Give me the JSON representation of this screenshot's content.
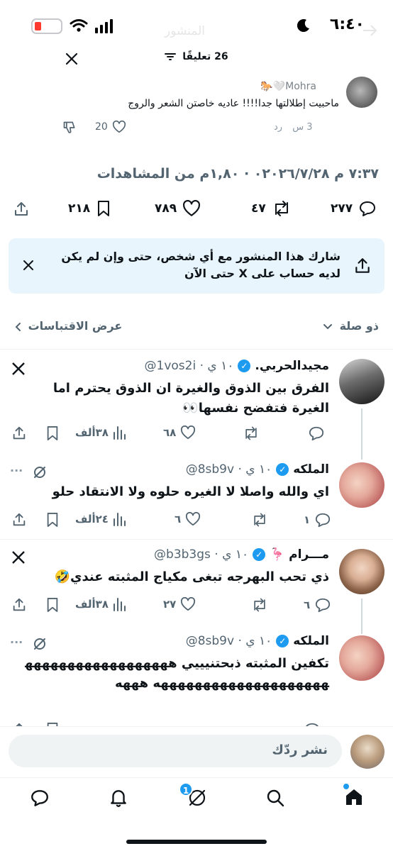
{
  "status_bar": {
    "time": "٦:٤٠",
    "ghost_title": "المنشور"
  },
  "sheet": {
    "comment_count": "26 تعليقًا"
  },
  "reply_preview": {
    "name": "Mohra🤍🐎",
    "text": "ماحبيت إطلالتها جدا!!!! عاديه خاصتن الشعر والروج",
    "time": "3 س",
    "reply_label": "رد",
    "likes": "20"
  },
  "post_meta": {
    "line": "٧:٣٧ م ٠٢٠٢٦/٧/٢٨ · ١,٨٠م من المشاهدات"
  },
  "post_actions": {
    "replies": "٢٧٧",
    "reposts": "٤٧",
    "likes": "٧٨٩",
    "bookmarks": "٢١٨"
  },
  "share_prompt": {
    "text": "شارك هذا المنشور مع أي شخص، حتى وإن لم يكن لديه حساب على X حتى الآن"
  },
  "sort_row": {
    "sort_label": "ذو صلة",
    "quotes_label": "عرض الاقتباسات"
  },
  "tweets": [
    {
      "name": "مجيدالحربي.",
      "handle": "@1vos2i · ١٠ ي",
      "text": "الفرق بين الذوق والغيرة ان الذوق يحترم اما الغيرة فتفضح نفسها👀",
      "replies": "",
      "reposts": "",
      "likes": "٦٨",
      "views": "٣٨ألف"
    },
    {
      "name": "الملكه",
      "handle": "@8sb9v · ١٠ ي",
      "text": "اي والله واصلا لا الغيره حلوه ولا الانتقاد حلو",
      "replies": "١",
      "reposts": "",
      "likes": "٦",
      "views": "٢٤ألف"
    },
    {
      "name": "مـــرام 🦩",
      "handle": "@b3b3gs · ١٠ ي",
      "text": "ذي تحب البهرجه تبغى مكياج المثبته عندي🤣",
      "replies": "٦",
      "reposts": "",
      "likes": "٢٧",
      "views": "٣٨ألف"
    },
    {
      "name": "الملكه",
      "handle": "@8sb9v · ١٠ ي",
      "text": "تكفين المثبته ذبحتنيييي ههههههههههههههههههههههههههههههههههههههه هههه",
      "replies": "",
      "reposts": "",
      "likes": "",
      "views": ""
    }
  ],
  "composer": {
    "placeholder": "نشر ردّك"
  },
  "nav": {
    "notification_badge": "1"
  },
  "colors": {
    "accent": "#1d9bf0",
    "text": "#0f1419",
    "muted": "#536471",
    "share_bg": "#e8f5fd"
  }
}
